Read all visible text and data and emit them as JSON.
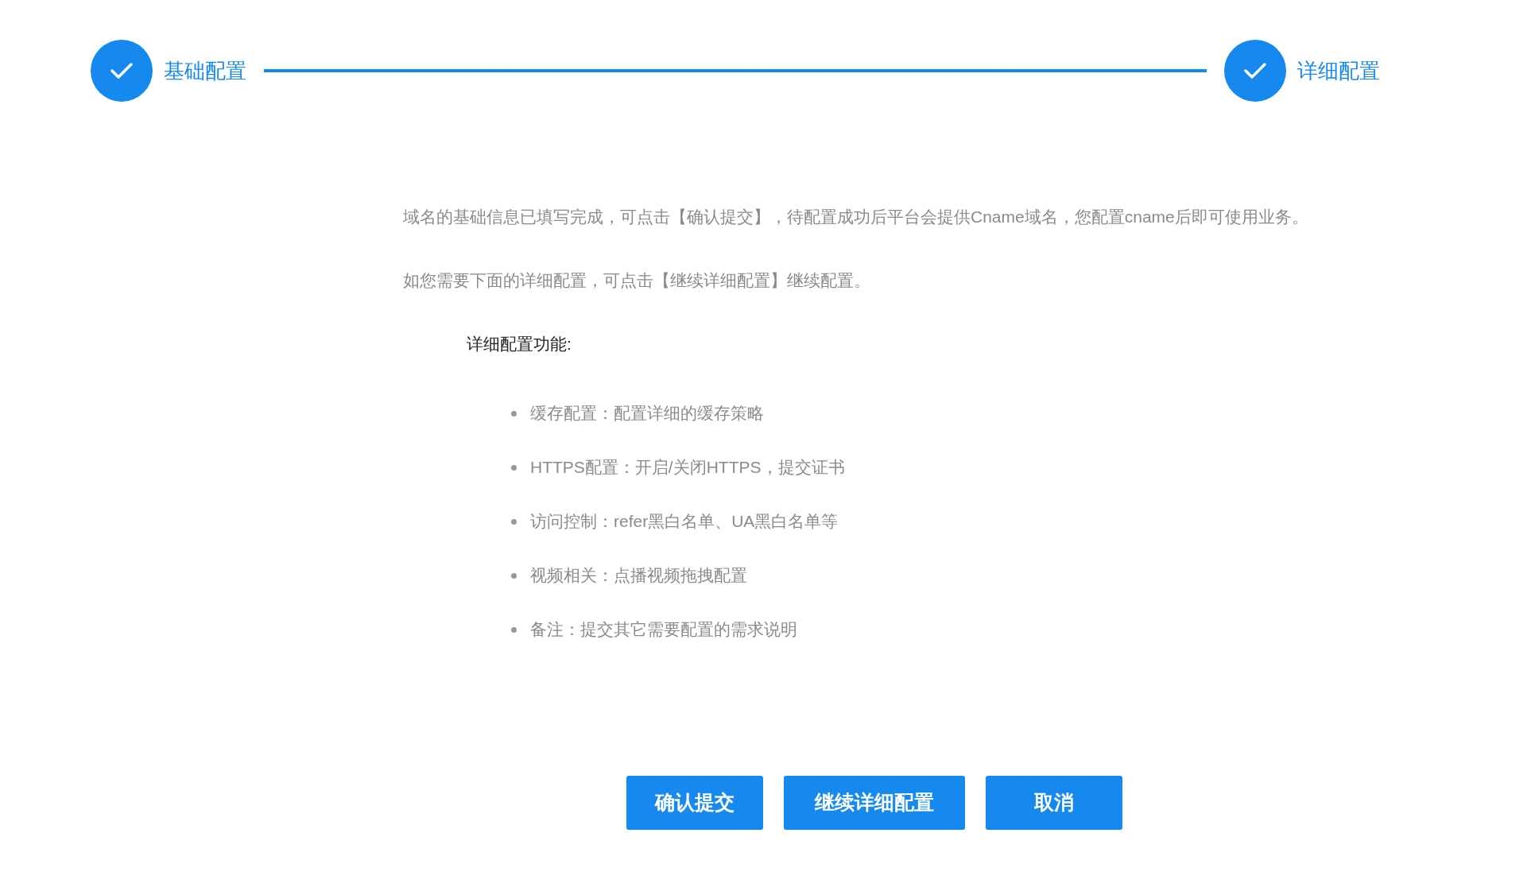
{
  "steps": [
    {
      "label": "基础配置",
      "done": true
    },
    {
      "label": "详细配置",
      "done": true
    }
  ],
  "intro": [
    "域名的基础信息已填写完成，可点击【确认提交】，待配置成功后平台会提供Cname域名，您配置cname后即可使用业务。",
    "如您需要下面的详细配置，可点击【继续详细配置】继续配置。"
  ],
  "features": {
    "title": "详细配置功能:",
    "items": [
      "缓存配置：配置详细的缓存策略",
      "HTTPS配置：开启/关闭HTTPS，提交证书",
      "访问控制：refer黑白名单、UA黑白名单等",
      "视频相关：点播视频拖拽配置",
      "备注：提交其它需要配置的需求说明"
    ]
  },
  "buttons": [
    "确认提交",
    "继续详细配置",
    "取消"
  ]
}
